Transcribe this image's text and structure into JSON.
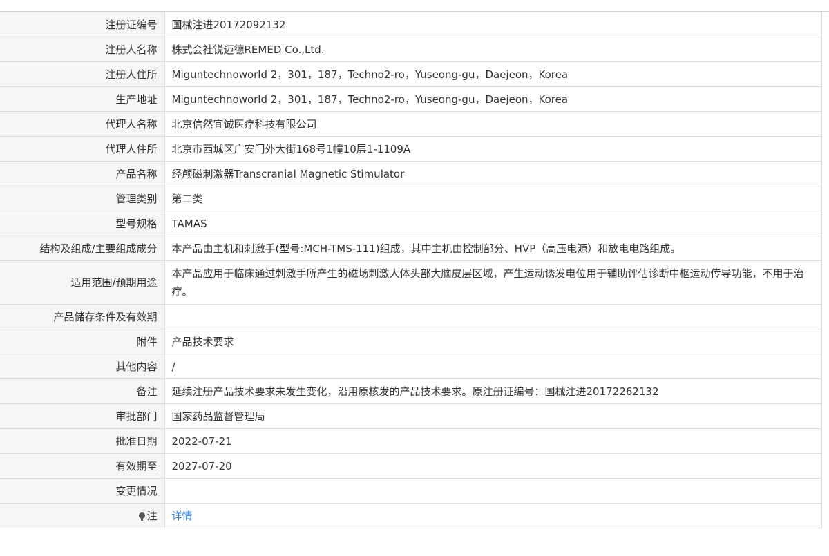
{
  "rows": [
    {
      "label": "注册证编号",
      "value": "国械注进20172092132"
    },
    {
      "label": "注册人名称",
      "value": "株式会社锐迈德REMED Co.,Ltd."
    },
    {
      "label": "注册人住所",
      "value": "Miguntechnoworld 2，301，187，Techno2-ro，Yuseong-gu，Daejeon，Korea"
    },
    {
      "label": "生产地址",
      "value": "Miguntechnoworld 2，301，187，Techno2-ro，Yuseong-gu，Daejeon，Korea"
    },
    {
      "label": "代理人名称",
      "value": "北京信然宜诚医疗科技有限公司"
    },
    {
      "label": "代理人住所",
      "value": "北京市西城区广安门外大街168号1幢10层1-1109A"
    },
    {
      "label": "产品名称",
      "value": "经颅磁刺激器Transcranial Magnetic Stimulator"
    },
    {
      "label": "管理类别",
      "value": "第二类"
    },
    {
      "label": "型号规格",
      "value": "TAMAS"
    },
    {
      "label": "结构及组成/主要组成成分",
      "value": "本产品由主机和刺激手(型号:MCH-TMS-111)组成，其中主机由控制部分、HVP（高压电源）和放电电路组成。"
    },
    {
      "label": "适用范围/预期用途",
      "value": "本产品应用于临床通过刺激手所产生的磁场刺激人体头部大脑皮层区域，产生运动诱发电位用于辅助评估诊断中枢运动传导功能，不用于治疗。"
    },
    {
      "label": "产品储存条件及有效期",
      "value": ""
    },
    {
      "label": "附件",
      "value": "产品技术要求"
    },
    {
      "label": "其他内容",
      "value": "/"
    },
    {
      "label": "备注",
      "value": "延续注册产品技术要求未发生变化，沿用原核发的产品技术要求。原注册证编号：国械注进20172262132"
    },
    {
      "label": "审批部门",
      "value": "国家药品监督管理局"
    },
    {
      "label": "批准日期",
      "value": "2022-07-21"
    },
    {
      "label": "有效期至",
      "value": "2027-07-20"
    },
    {
      "label": "变更情况",
      "value": ""
    }
  ],
  "note_row": {
    "label": "注",
    "icon": "lightbulb-icon",
    "link_text": "详情"
  },
  "colors": {
    "label_bg": "#f6f6f6",
    "border": "#dddddd",
    "link": "#2f7fd6",
    "text": "#333333"
  }
}
